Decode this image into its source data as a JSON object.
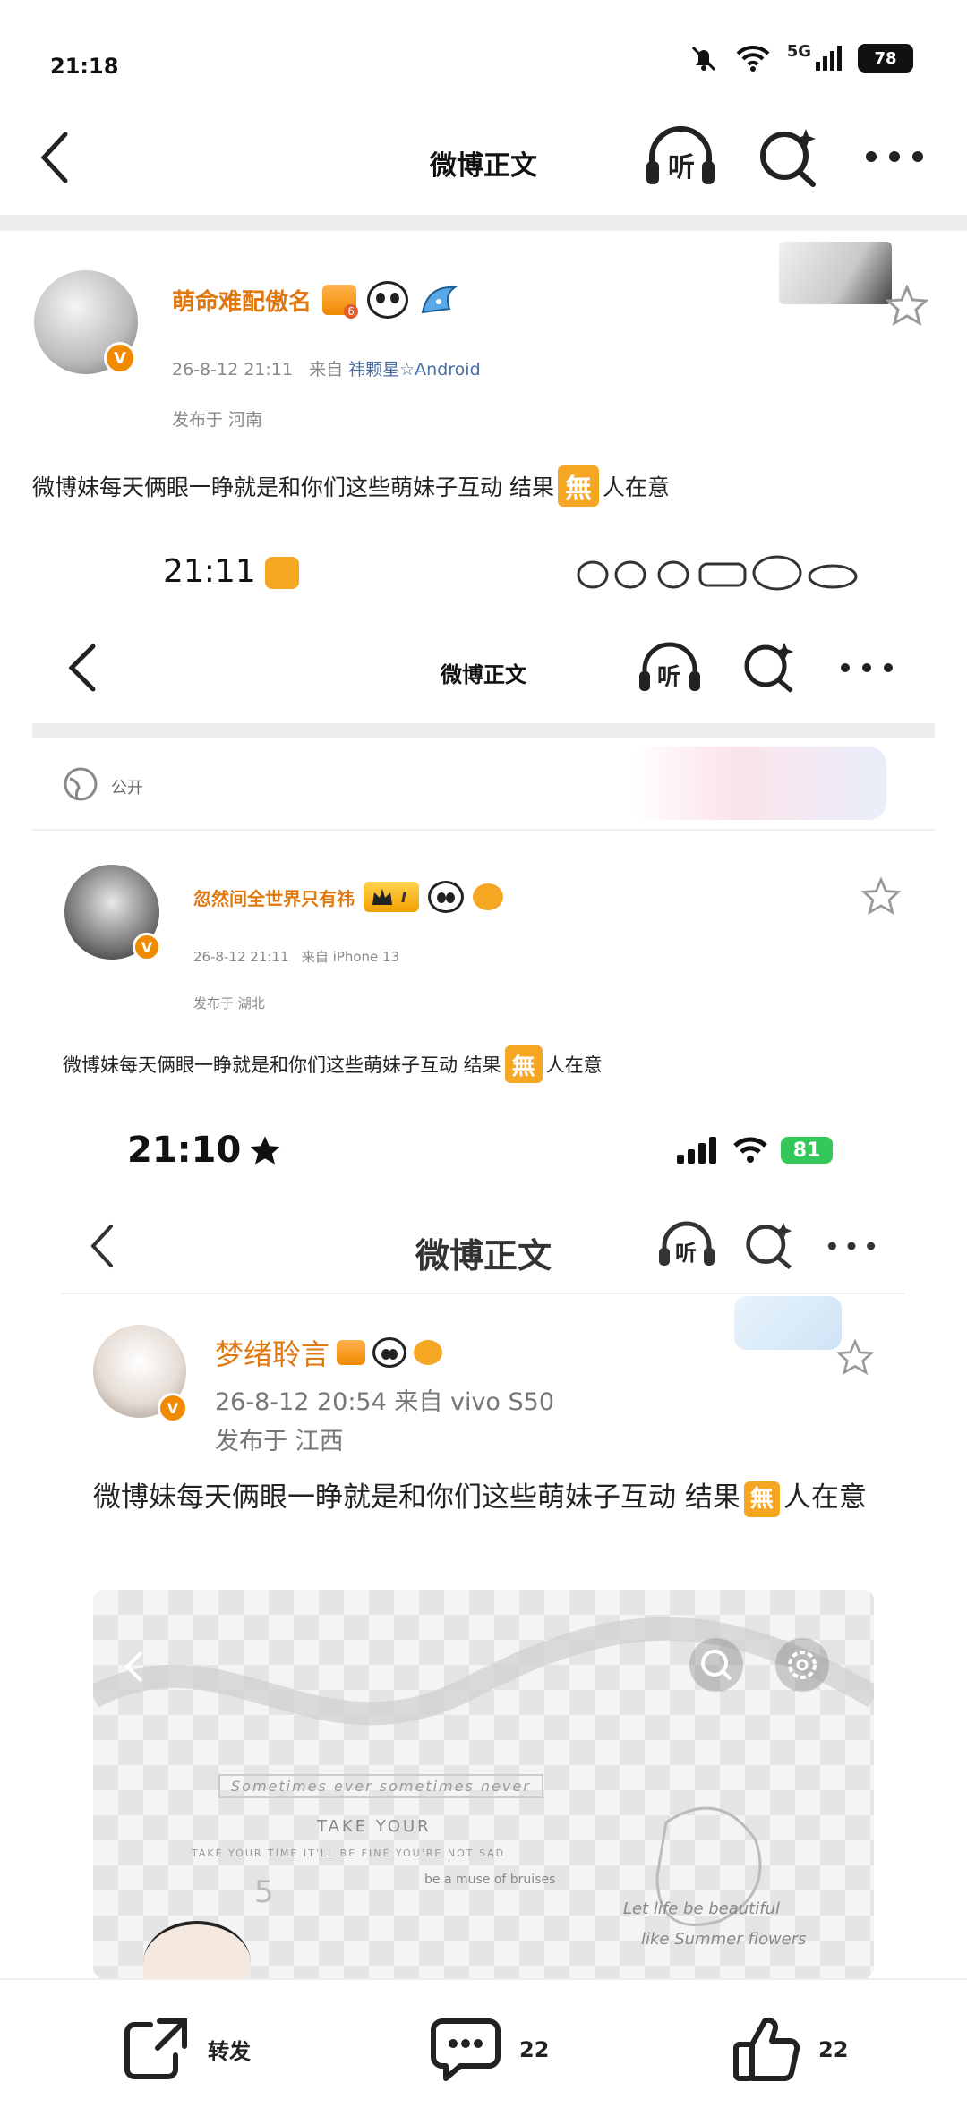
{
  "status_bar": {
    "time": "21:18",
    "network": "5G",
    "battery": "78"
  },
  "header": {
    "title": "微博正文",
    "listen_label": "听"
  },
  "post": {
    "username": "萌命难配傲名",
    "badge_level": "6",
    "date": "26-8-12 21:11",
    "source_prefix": "来自",
    "source": "祎颗星☆Android",
    "location": "发布于 河南",
    "text_before": "微博妹每天俩眼一睁就是和你们这些萌妹子互动  结果",
    "wu": "無",
    "text_after": "人在意"
  },
  "screenshot1": {
    "time": "21:11",
    "title": "微博正文",
    "listen_label": "听",
    "visibility": "公开",
    "username": "忽然间全世界只有祎",
    "rank": "I",
    "date": "26-8-12 21:11",
    "source_prefix": "来自",
    "source": "iPhone 13",
    "location": "发布于 湖北",
    "text_before": "微博妹每天俩眼一睁就是和你们这些萌妹子互动  结果",
    "wu": "無",
    "text_after": "人在意"
  },
  "screenshot2": {
    "time": "21:10",
    "battery": "81",
    "title": "微博正文",
    "listen_label": "听",
    "username": "梦绪聆言",
    "date": "26-8-12 20:54",
    "source_prefix": "来自",
    "source": "vivo S50",
    "location": "发布于 江西",
    "text_before": "微博妹每天俩眼一睁就是和你们这些萌妹子互动  结果",
    "wu": "無",
    "text_after": "人在意",
    "image_texts": {
      "line1": "Sometimes ever  sometimes never",
      "line2": "TAKE YOUR",
      "line3": "TAKE YOUR TIME IT'LL BE FINE YOU'RE NOT SAD",
      "line4": "be a muse of bruises",
      "line5": "Let life be beautiful",
      "line6": "like Summer flowers",
      "num": "5"
    }
  },
  "actions": {
    "repost_label": "转发",
    "comment_count": "22",
    "like_count": "22"
  },
  "colors": {
    "accent": "#e07810",
    "wu_bg": "#f5a623",
    "battery_green": "#34c759"
  }
}
